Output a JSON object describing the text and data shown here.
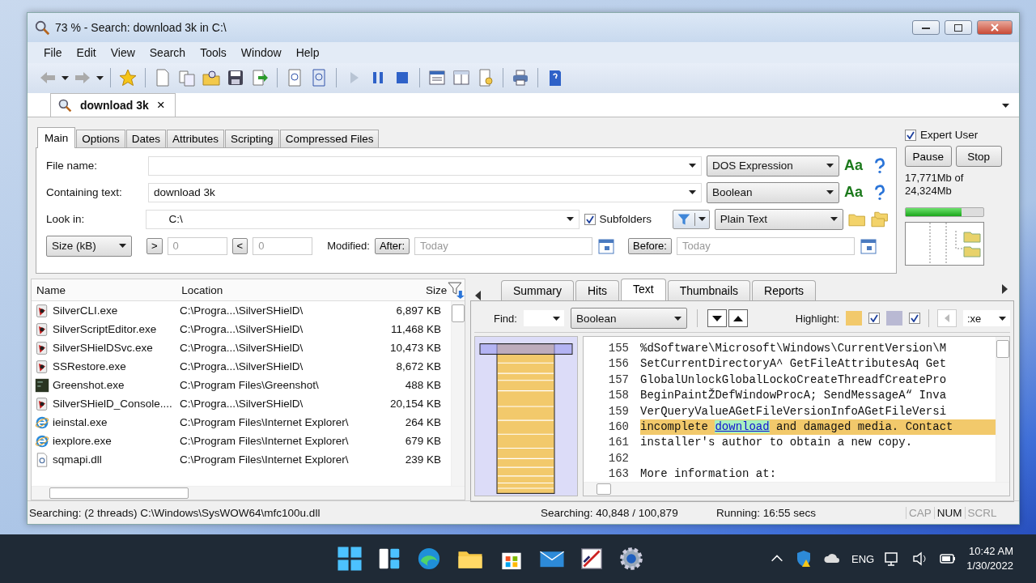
{
  "window": {
    "title": "73 % - Search: download 3k in C:\\"
  },
  "menu": [
    "File",
    "Edit",
    "View",
    "Search",
    "Tools",
    "Window",
    "Help"
  ],
  "doc_tab": {
    "label": "download 3k",
    "close": "×"
  },
  "criteria_tabs": [
    {
      "label": "Main",
      "selected": true
    },
    {
      "label": "Options",
      "selected": false
    },
    {
      "label": "Dates",
      "selected": false
    },
    {
      "label": "Attributes",
      "selected": false
    },
    {
      "label": "Scripting",
      "selected": false
    },
    {
      "label": "Compressed Files",
      "selected": false
    }
  ],
  "fields": [
    {
      "label": "File name:",
      "mode": "DOS Expression",
      "case_label": "Aa"
    },
    {
      "label": "Containing text:",
      "value": "download 3k",
      "mode": "Boolean",
      "case_label": "Aa"
    }
  ],
  "look_in": {
    "label": "Look in:",
    "value": "C:\\",
    "subfolders": {
      "label": "Subfolders",
      "checked": true
    },
    "type": "Plain Text"
  },
  "size_filter": {
    "unit": "Size (kB)",
    "greater": ">",
    "greater_value": "0",
    "less": "<",
    "less_value": "0"
  },
  "modified": {
    "label": "Modified:",
    "after": "After:",
    "after_placeholder": "Today",
    "before": "Before:",
    "before_placeholder": "Today"
  },
  "side": {
    "expert_user": {
      "label": "Expert User",
      "checked": true
    },
    "buttons": [
      "Pause",
      "Stop"
    ],
    "progress_text": "17,771Mb of 24,324Mb",
    "level": 0.72
  },
  "results": {
    "columns": [
      "Name",
      "Location",
      "Size"
    ],
    "rows": [
      {
        "kind": "shield",
        "name": "SilverCLI.exe",
        "location": "C:\\Progra...\\SilverSHielD\\",
        "size": "6,897 KB"
      },
      {
        "kind": "shield",
        "name": "SilverScriptEditor.exe",
        "location": "C:\\Progra...\\SilverSHielD\\",
        "size": "11,468 KB"
      },
      {
        "kind": "shield",
        "name": "SilverSHielDSvc.exe",
        "location": "C:\\Progra...\\SilverSHielD\\",
        "size": "10,473 KB"
      },
      {
        "kind": "shield",
        "name": "SSRestore.exe",
        "location": "C:\\Progra...\\SilverSHielD\\",
        "size": "8,672 KB"
      },
      {
        "kind": "screen",
        "name": "Greenshot.exe",
        "location": "C:\\Program Files\\Greenshot\\",
        "size": "488 KB"
      },
      {
        "kind": "shield",
        "name": "SilverSHielD_Console....",
        "location": "C:\\Progra...\\SilverSHielD\\",
        "size": "20,154 KB"
      },
      {
        "kind": "browser",
        "name": "ieinstal.exe",
        "location": "C:\\Program Files\\Internet Explorer\\",
        "size": "264 KB"
      },
      {
        "kind": "browser",
        "name": "iexplore.exe",
        "location": "C:\\Program Files\\Internet Explorer\\",
        "size": "679 KB"
      },
      {
        "kind": "dll",
        "name": "sqmapi.dll",
        "location": "C:\\Program Files\\Internet Explorer\\",
        "size": "239 KB"
      }
    ]
  },
  "result_tabs": [
    {
      "label": "Summary",
      "selected": false
    },
    {
      "label": "Hits",
      "selected": false
    },
    {
      "label": "Text",
      "selected": true
    },
    {
      "label": "Thumbnails",
      "selected": false
    },
    {
      "label": "Reports",
      "selected": false
    }
  ],
  "find_bar": {
    "label": "Find:",
    "mode": "Boolean",
    "highlight_label": "Highlight:",
    "highlights": [
      {
        "color": "#f2c96b",
        "checked": true
      },
      {
        "color": "#b9b9d3",
        "checked": true
      }
    ],
    "extension": ":xe"
  },
  "text_lines": [
    {
      "number": "155",
      "highlighted": false,
      "segments": [
        {
          "text": "%dSoftware\\Microsoft\\Windows\\CurrentVersion\\M",
          "hit": false
        }
      ]
    },
    {
      "number": "156",
      "highlighted": false,
      "segments": [
        {
          "text": "SetCurrentDirectoryA^ GetFileAttributesAq Get",
          "hit": false
        }
      ]
    },
    {
      "number": "157",
      "highlighted": false,
      "segments": [
        {
          "text": "GlobalUnlockGlobalLockoCreateThreadfCreatePro",
          "hit": false
        }
      ]
    },
    {
      "number": "158",
      "highlighted": false,
      "segments": [
        {
          "text": "BeginPaintŽDefWindowProcA; SendMessageA“ Inva",
          "hit": false
        }
      ]
    },
    {
      "number": "159",
      "highlighted": false,
      "segments": [
        {
          "text": "VerQueryValueAGetFileVersionInfoAGetFileVersi",
          "hit": false
        }
      ]
    },
    {
      "number": "160",
      "highlighted": true,
      "segments": [
        {
          "text": "incomplete ",
          "hit": false
        },
        {
          "text": "download",
          "hit": true
        },
        {
          "text": " and damaged media. Contact",
          "hit": false
        }
      ]
    },
    {
      "number": "161",
      "highlighted": false,
      "segments": [
        {
          "text": "installer's author to obtain a new copy.",
          "hit": false
        }
      ]
    },
    {
      "number": "162",
      "highlighted": false
    },
    {
      "number": "163",
      "highlighted": false,
      "segments": [
        {
          "text": "More information at:",
          "hit": false
        }
      ]
    }
  ],
  "status_bar": {
    "sections": [
      "Searching: (2 threads) C:\\Windows\\SysWOW64\\mfc100u.dll",
      "Searching: 40,848 / 100,879",
      "Running: 16:55 secs"
    ],
    "indicators": [
      {
        "label": "CAP",
        "on": false
      },
      {
        "label": "NUM",
        "on": true
      },
      {
        "label": "SCRL",
        "on": false
      }
    ]
  },
  "taskbar": {
    "language": "ENG",
    "time": "10:42 AM",
    "date": "1/30/2022"
  }
}
